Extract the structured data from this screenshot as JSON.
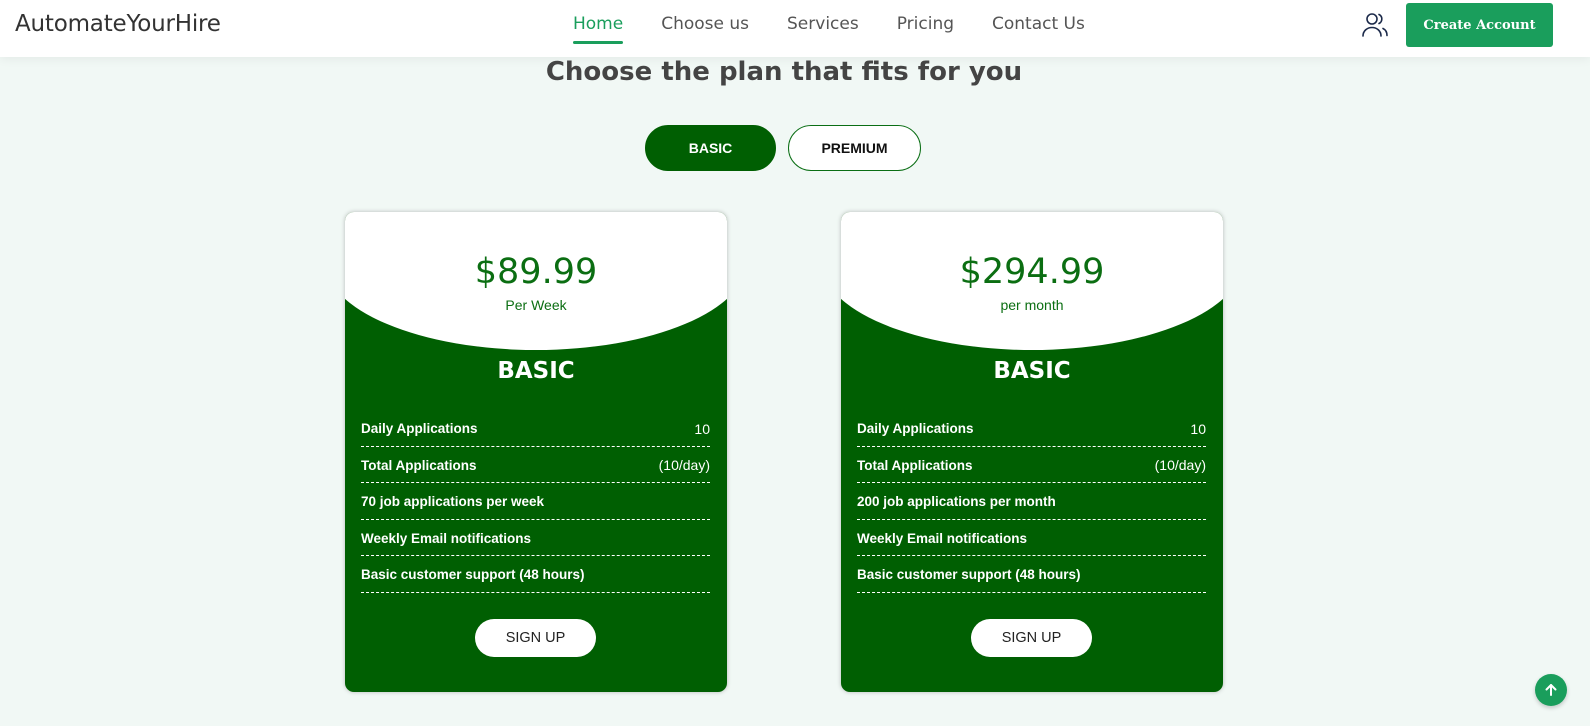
{
  "nav": {
    "brand": "AutomateYourHire",
    "links": [
      {
        "label": "Home",
        "active": true
      },
      {
        "label": "Choose us",
        "active": false
      },
      {
        "label": "Services",
        "active": false
      },
      {
        "label": "Pricing",
        "active": false
      },
      {
        "label": "Contact Us",
        "active": false
      }
    ],
    "user_icon": "users-icon",
    "create_account_label": "Create Account"
  },
  "pricing": {
    "headline": "Choose the plan that fits for you",
    "toggle": {
      "basic_label": "BASIC",
      "premium_label": "PREMIUM",
      "selected": "BASIC"
    },
    "plans": [
      {
        "price": "$89.99",
        "period": "Per Week",
        "name": "BASIC",
        "features": [
          {
            "label": "Daily Applications",
            "value": "10"
          },
          {
            "label": "Total Applications",
            "value": "(10/day)"
          },
          {
            "label": "70 job applications per week",
            "value": ""
          },
          {
            "label": "Weekly Email notifications",
            "value": ""
          },
          {
            "label": "Basic customer support (48 hours)",
            "value": ""
          }
        ],
        "cta_label": "SIGN UP"
      },
      {
        "price": "$294.99",
        "period": "per month",
        "name": "BASIC",
        "features": [
          {
            "label": "Daily Applications",
            "value": "10"
          },
          {
            "label": "Total Applications",
            "value": "(10/day)"
          },
          {
            "label": "200 job applications per month",
            "value": ""
          },
          {
            "label": "Weekly Email notifications",
            "value": ""
          },
          {
            "label": "Basic customer support (48 hours)",
            "value": ""
          }
        ],
        "cta_label": "SIGN UP"
      }
    ]
  },
  "scroll_top_icon": "arrow-up-icon",
  "colors": {
    "accent": "#1a9e5c",
    "card_green": "#005f02",
    "price_green": "#0b6e12",
    "page_background": "#f1f8f5"
  }
}
